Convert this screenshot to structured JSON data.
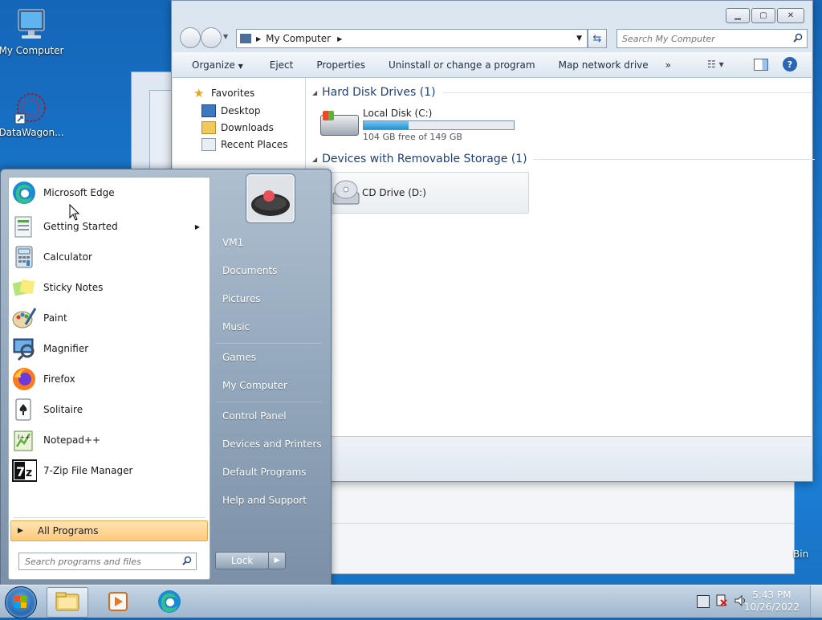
{
  "desktop": {
    "icons": [
      {
        "label": "My Computer"
      },
      {
        "label": "DataWagon..."
      },
      {
        "label": "Bin"
      }
    ]
  },
  "explorer": {
    "address_parts": [
      "My Computer"
    ],
    "search_placeholder": "Search My Computer",
    "toolbar": {
      "organize": "Organize",
      "eject": "Eject",
      "properties": "Properties",
      "uninstall": "Uninstall or change a program",
      "map_drive": "Map network drive",
      "more": "»"
    },
    "nav": {
      "favorites": "Favorites",
      "desktop": "Desktop",
      "downloads": "Downloads",
      "recent": "Recent Places"
    },
    "groups": {
      "hdd": "Hard Disk Drives (1)",
      "removable": "Devices with Removable Storage (1)"
    },
    "drives": {
      "local_name": "Local Disk (C:)",
      "local_free": "104 GB free of 149 GB",
      "local_used_fraction": 0.302,
      "cd_name": "CD Drive (D:)"
    }
  },
  "start_menu": {
    "programs": [
      {
        "label": "Microsoft Edge",
        "icon": "edge-icon"
      },
      {
        "label": "Getting Started",
        "icon": "getting-started-icon"
      },
      {
        "label": "Calculator",
        "icon": "calculator-icon"
      },
      {
        "label": "Sticky Notes",
        "icon": "sticky-notes-icon"
      },
      {
        "label": "Paint",
        "icon": "paint-icon"
      },
      {
        "label": "Magnifier",
        "icon": "magnifier-icon"
      },
      {
        "label": "Firefox",
        "icon": "firefox-icon"
      },
      {
        "label": "Solitaire",
        "icon": "solitaire-icon"
      },
      {
        "label": "Notepad++",
        "icon": "notepadpp-icon"
      },
      {
        "label": "7-Zip File Manager",
        "icon": "7zip-icon"
      }
    ],
    "all_programs": "All Programs",
    "search_placeholder": "Search programs and files",
    "right": {
      "user": "VM1",
      "documents": "Documents",
      "pictures": "Pictures",
      "music": "Music",
      "games": "Games",
      "computer": "My Computer",
      "control_panel": "Control Panel",
      "devices": "Devices and Printers",
      "defaults": "Default Programs",
      "help": "Help and Support"
    },
    "lock": "Lock",
    "lock_arrow": "▶"
  },
  "taskbar": {
    "time": "5:43 PM",
    "date": "10/26/2022"
  }
}
